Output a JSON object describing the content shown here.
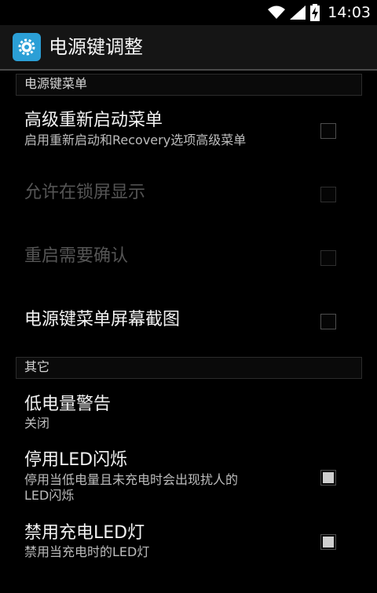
{
  "status_bar": {
    "time": "14:03",
    "icons": [
      "wifi-icon",
      "signal-icon",
      "battery-charging-icon"
    ]
  },
  "action_bar": {
    "app_icon": "settings-gear-icon",
    "title": "电源键调整"
  },
  "sections": [
    {
      "header": "电源键菜单",
      "items": [
        {
          "title": "高级重新启动菜单",
          "summary": "启用重新启动和Recovery选项高级菜单",
          "checked": false,
          "enabled": true
        },
        {
          "title": "允许在锁屏显示",
          "summary": "",
          "checked": false,
          "enabled": false
        },
        {
          "title": "重启需要确认",
          "summary": "",
          "checked": false,
          "enabled": false
        },
        {
          "title": "电源键菜单屏幕截图",
          "summary": "",
          "checked": false,
          "enabled": true
        }
      ]
    },
    {
      "header": "其它",
      "items": [
        {
          "title": "低电量警告",
          "summary": "关闭"
        },
        {
          "title": "停用LED闪烁",
          "summary": "停用当低电量且未充电时会出现扰人的LED闪烁",
          "checked": true,
          "enabled": true
        },
        {
          "title": "禁用充电LED灯",
          "summary": "禁用当充电时的LED灯",
          "checked": true,
          "enabled": true
        }
      ]
    }
  ]
}
